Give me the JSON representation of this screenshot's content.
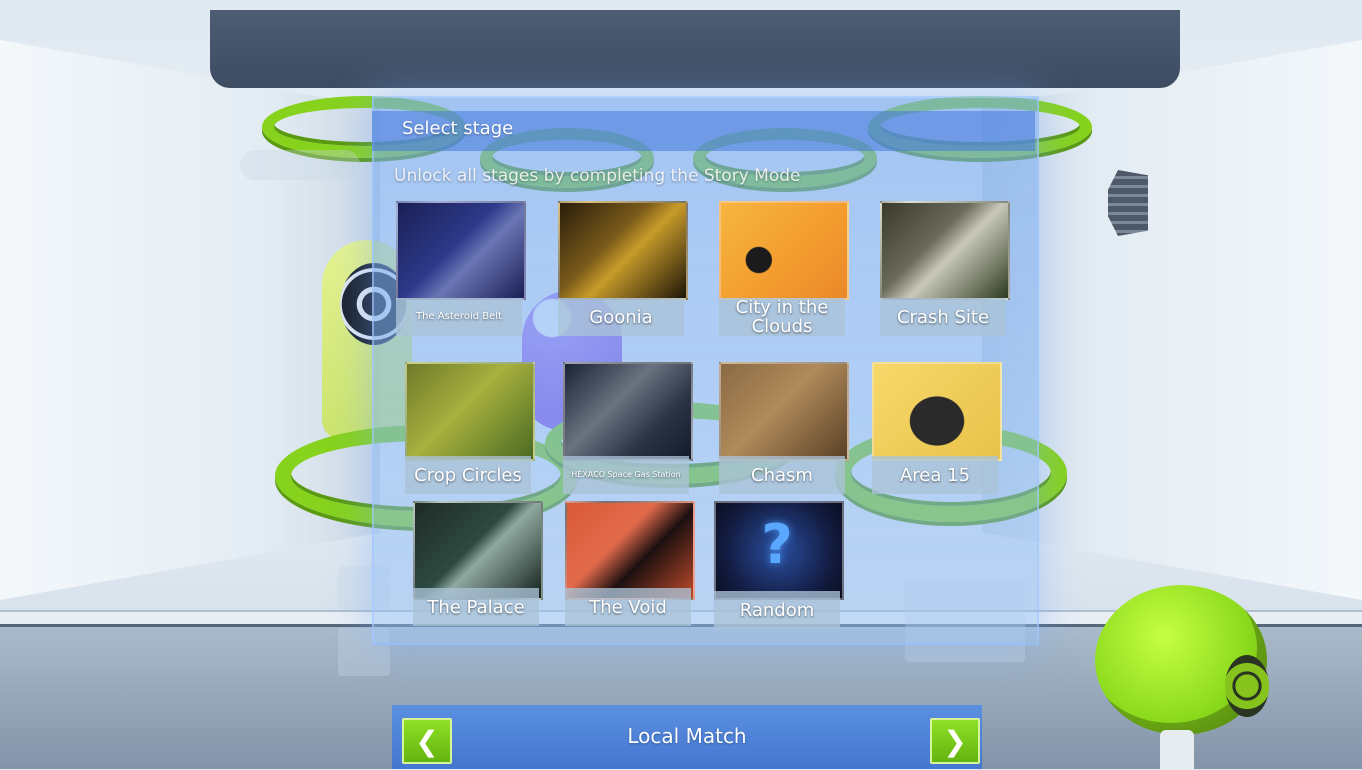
{
  "stage_select": {
    "title": "Select stage",
    "subtitle": "Unlock all stages by completing the Story Mode",
    "stages": [
      {
        "label": "The Asteroid Belt"
      },
      {
        "label": "Goonia"
      },
      {
        "label": "City in the Clouds"
      },
      {
        "label": "Crash Site"
      },
      {
        "label": "Crop Circles"
      },
      {
        "label": "HEXACO Space Gas Station"
      },
      {
        "label": "Chasm"
      },
      {
        "label": "Area 15"
      },
      {
        "label": "The Palace"
      },
      {
        "label": "The Void"
      },
      {
        "label": "Random"
      }
    ]
  },
  "footer": {
    "mode_label": "Local Match",
    "prev_icon": "chevron-left-icon",
    "next_icon": "chevron-right-icon"
  },
  "colors": {
    "accent_green": "#86d21c",
    "panel_blue": "#5a8fe0",
    "ceiling": "#4d5d74"
  }
}
